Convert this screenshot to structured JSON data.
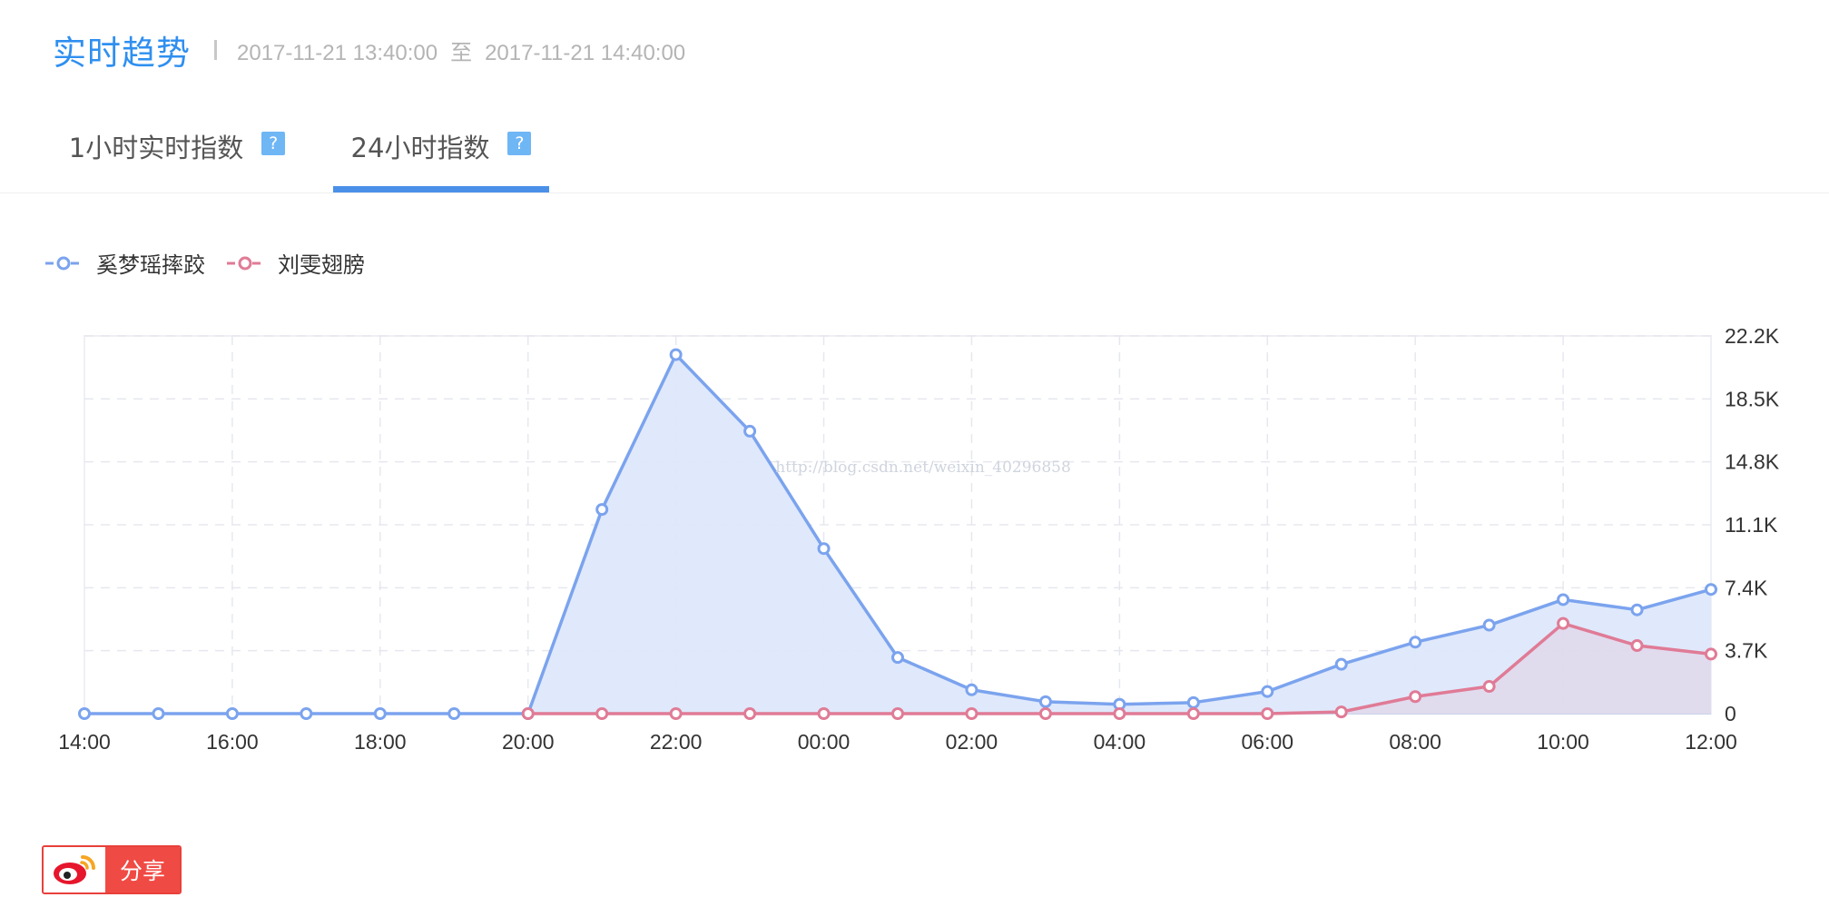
{
  "header": {
    "title": "实时趋势",
    "separator": "|",
    "range_start": "2017-11-21 13:40:00",
    "range_to": "至",
    "range_end": "2017-11-21 14:40:00"
  },
  "tabs": [
    {
      "label": "1小时实时指数",
      "help": "?",
      "active": false
    },
    {
      "label": "24小时指数",
      "help": "?",
      "active": true
    }
  ],
  "share": {
    "label": "分享",
    "icon": "weibo-icon"
  },
  "watermark": "http://blog.csdn.net/weixin_40296858",
  "colors": {
    "accent": "#2f8ff0",
    "series1": "#7ba3ee",
    "series1_fill": "#dde8fb",
    "series2": "#e07b96",
    "series2_fill": "#e2d6ea",
    "share_red": "#f04a44"
  },
  "chart_data": {
    "type": "area",
    "title": "",
    "xlabel": "",
    "ylabel": "",
    "x": [
      "14:00",
      "15:00",
      "16:00",
      "17:00",
      "18:00",
      "19:00",
      "20:00",
      "21:00",
      "22:00",
      "23:00",
      "00:00",
      "01:00",
      "02:00",
      "03:00",
      "04:00",
      "05:00",
      "06:00",
      "07:00",
      "08:00",
      "09:00",
      "10:00",
      "11:00",
      "12:00"
    ],
    "x_tick_labels": [
      "14:00",
      "16:00",
      "18:00",
      "20:00",
      "22:00",
      "00:00",
      "02:00",
      "04:00",
      "06:00",
      "08:00",
      "10:00",
      "12:00"
    ],
    "y_tick_labels": [
      "0",
      "3.7K",
      "7.4K",
      "11.1K",
      "14.8K",
      "18.5K",
      "22.2K"
    ],
    "ylim": [
      0,
      22200
    ],
    "y_axis_position": "right",
    "grid": true,
    "legend_position": "top-left",
    "series": [
      {
        "name": "奚梦瑶摔跤",
        "values": [
          0,
          0,
          0,
          0,
          0,
          0,
          0,
          12000,
          21100,
          16600,
          9700,
          3300,
          1400,
          700,
          550,
          650,
          1300,
          2900,
          4200,
          5200,
          6700,
          6100,
          7300
        ]
      },
      {
        "name": "刘雯翅膀",
        "values": [
          null,
          null,
          null,
          null,
          null,
          null,
          0,
          0,
          0,
          0,
          0,
          0,
          0,
          0,
          0,
          0,
          0,
          100,
          1000,
          1600,
          5300,
          4000,
          3500
        ]
      }
    ]
  }
}
